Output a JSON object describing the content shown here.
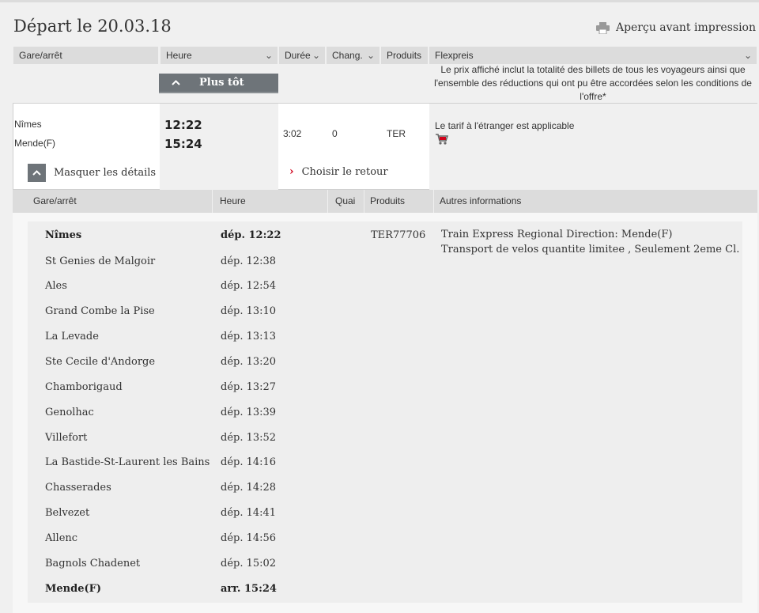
{
  "title": "Départ le 20.03.18",
  "print_label": "Aperçu avant impression",
  "columns": [
    {
      "label": "Gare/arrêt",
      "chevron": false
    },
    {
      "label": "Heure",
      "chevron": true
    },
    {
      "label": "Durée",
      "chevron": true
    },
    {
      "label": "Chang.",
      "chevron": true
    },
    {
      "label": "Produits",
      "chevron": false
    },
    {
      "label": "Flexpreis",
      "chevron": true
    }
  ],
  "flex_note": "Le prix affiché inclut la totalité des billets de tous les voyageurs ainsi que l'ensemble des réductions qui ont pu être accordées selon les conditions de l'offre*",
  "earlier_button": "Plus tôt",
  "result": {
    "from": "Nîmes",
    "to": "Mende(F)",
    "dep": "12:22",
    "arr": "15:24",
    "duration": "3:02",
    "changes": "0",
    "product": "TER",
    "info": "Le tarif à l'étranger est applicable",
    "hide_details": "Masquer les détails",
    "choose_return": "Choisir le retour",
    "icons": {
      "cart": "shopping-cart-icon",
      "print": "printer-icon"
    },
    "accent_color": "#d0021b"
  },
  "details_header": {
    "station": "Gare/arrêt",
    "time": "Heure",
    "platform": "Quai",
    "products": "Produits",
    "other": "Autres informations"
  },
  "stops": [
    {
      "name": "Nîmes",
      "time": "dép. 12:22",
      "bold": true
    },
    {
      "name": "St Genies de Malgoir",
      "time": "dép. 12:38",
      "bold": false
    },
    {
      "name": "Ales",
      "time": "dép. 12:54",
      "bold": false
    },
    {
      "name": "Grand Combe la Pise",
      "time": "dép. 13:10",
      "bold": false
    },
    {
      "name": "La Levade",
      "time": "dép. 13:13",
      "bold": false
    },
    {
      "name": "Ste Cecile d'Andorge",
      "time": "dép. 13:20",
      "bold": false
    },
    {
      "name": "Chamborigaud",
      "time": "dép. 13:27",
      "bold": false
    },
    {
      "name": "Genolhac",
      "time": "dép. 13:39",
      "bold": false
    },
    {
      "name": "Villefort",
      "time": "dép. 13:52",
      "bold": false
    },
    {
      "name": "La Bastide-St-Laurent les Bains",
      "time": "dép. 14:16",
      "bold": false
    },
    {
      "name": "Chasserades",
      "time": "dép. 14:28",
      "bold": false
    },
    {
      "name": "Belvezet",
      "time": "dép. 14:41",
      "bold": false
    },
    {
      "name": "Allenc",
      "time": "dép. 14:56",
      "bold": false
    },
    {
      "name": "Bagnols Chadenet",
      "time": "dép. 15:02",
      "bold": false
    },
    {
      "name": "Mende(F)",
      "time": "arr. 15:24",
      "bold": true
    }
  ],
  "train_product": "TER77706",
  "other_info": [
    "Train Express Regional Direction: Mende(F)",
    "Transport de velos quantite limitee , Seulement 2eme Cl."
  ]
}
